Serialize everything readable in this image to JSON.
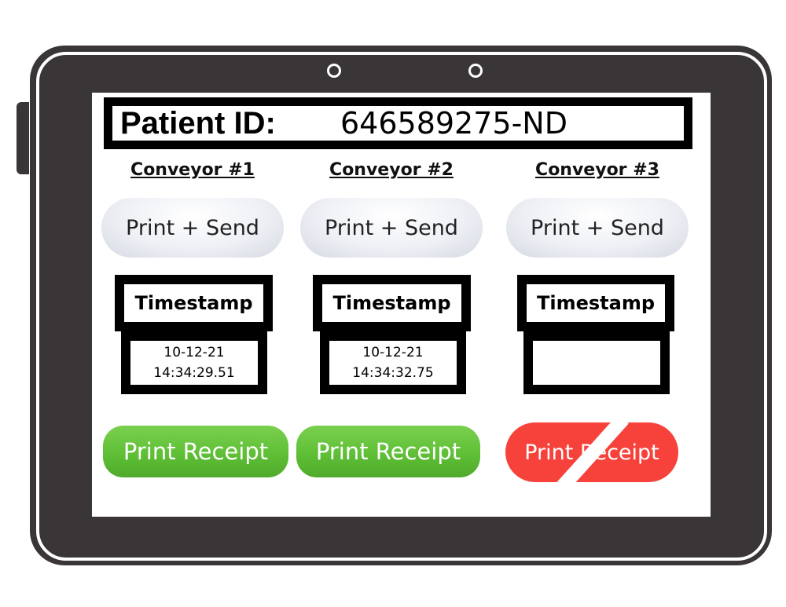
{
  "patient": {
    "label": "Patient ID:",
    "value": "646589275-ND"
  },
  "conveyors": [
    {
      "title": "Conveyor #1",
      "send_label": "Print + Send",
      "timestamp_label": "Timestamp",
      "timestamp_date": "10-12-21",
      "timestamp_time": "14:34:29.51",
      "receipt_label": "Print Receipt",
      "receipt_enabled": true
    },
    {
      "title": "Conveyor #2",
      "send_label": "Print + Send",
      "timestamp_label": "Timestamp",
      "timestamp_date": "10-12-21",
      "timestamp_time": "14:34:32.75",
      "receipt_label": "Print Receipt",
      "receipt_enabled": true
    },
    {
      "title": "Conveyor #3",
      "send_label": "Print + Send",
      "timestamp_label": "Timestamp",
      "timestamp_date": "",
      "timestamp_time": "",
      "receipt_label": "Print Receipt",
      "receipt_enabled": false
    }
  ],
  "colors": {
    "receipt_enabled": "#5fbf36",
    "receipt_disabled": "#f7423c",
    "device_frame": "#3a3637"
  },
  "icons": {
    "camera": "camera-icon",
    "disabled_slash": "disabled-slash-icon"
  }
}
